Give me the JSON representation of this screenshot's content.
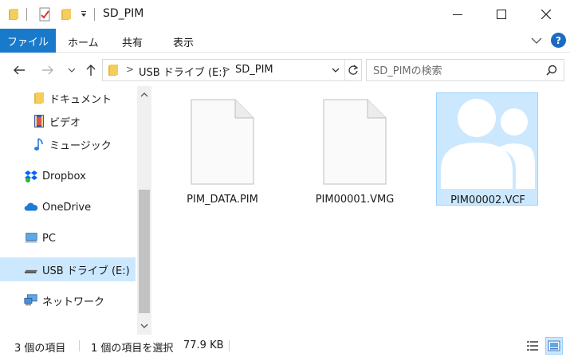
{
  "window": {
    "title": "SD_PIM",
    "minimize_icon": "minimize-icon",
    "maximize_icon": "maximize-icon",
    "close_icon": "close-icon"
  },
  "ribbon": {
    "file_tab": "ファイル",
    "tabs": [
      "ホーム",
      "共有",
      "表示"
    ],
    "help_label": "?",
    "accent_color": "#1979ca"
  },
  "address": {
    "crumbs": [
      "USB ドライブ (E:)",
      "SD_PIM"
    ]
  },
  "search": {
    "placeholder": "SD_PIMの検索"
  },
  "nav": {
    "items": [
      {
        "label": "ドキュメント",
        "icon": "documents-folder-icon"
      },
      {
        "label": "ビデオ",
        "icon": "videos-icon"
      },
      {
        "label": "ミュージック",
        "icon": "music-icon"
      },
      {
        "label": "Dropbox",
        "icon": "dropbox-icon"
      },
      {
        "label": "OneDrive",
        "icon": "onedrive-icon"
      },
      {
        "label": "PC",
        "icon": "pc-icon"
      },
      {
        "label": "USB ドライブ (E:)",
        "icon": "usb-drive-icon",
        "selected": true
      },
      {
        "label": "ネットワーク",
        "icon": "network-icon"
      }
    ]
  },
  "files": [
    {
      "name": "PIM_DATA.PIM",
      "icon": "generic-file-icon"
    },
    {
      "name": "PIM00001.VMG",
      "icon": "generic-file-icon"
    },
    {
      "name": "PIM00002.VCF",
      "icon": "contact-card-icon",
      "selected": true
    }
  ],
  "status": {
    "item_count": "3 個の項目",
    "selection": "1 個の項目を選択",
    "size": "77.9 KB"
  }
}
